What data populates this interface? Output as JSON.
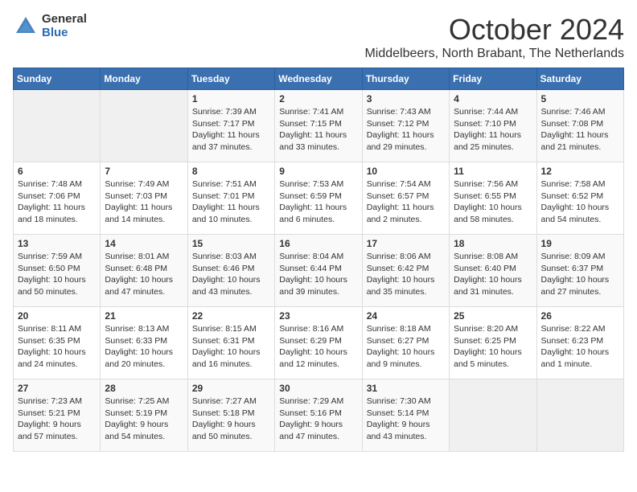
{
  "header": {
    "logo_general": "General",
    "logo_blue": "Blue",
    "month_title": "October 2024",
    "location": "Middelbeers, North Brabant, The Netherlands"
  },
  "days_of_week": [
    "Sunday",
    "Monday",
    "Tuesday",
    "Wednesday",
    "Thursday",
    "Friday",
    "Saturday"
  ],
  "weeks": [
    [
      {
        "day": "",
        "content": ""
      },
      {
        "day": "",
        "content": ""
      },
      {
        "day": "1",
        "content": "Sunrise: 7:39 AM\nSunset: 7:17 PM\nDaylight: 11 hours and 37 minutes."
      },
      {
        "day": "2",
        "content": "Sunrise: 7:41 AM\nSunset: 7:15 PM\nDaylight: 11 hours and 33 minutes."
      },
      {
        "day": "3",
        "content": "Sunrise: 7:43 AM\nSunset: 7:12 PM\nDaylight: 11 hours and 29 minutes."
      },
      {
        "day": "4",
        "content": "Sunrise: 7:44 AM\nSunset: 7:10 PM\nDaylight: 11 hours and 25 minutes."
      },
      {
        "day": "5",
        "content": "Sunrise: 7:46 AM\nSunset: 7:08 PM\nDaylight: 11 hours and 21 minutes."
      }
    ],
    [
      {
        "day": "6",
        "content": "Sunrise: 7:48 AM\nSunset: 7:06 PM\nDaylight: 11 hours and 18 minutes."
      },
      {
        "day": "7",
        "content": "Sunrise: 7:49 AM\nSunset: 7:03 PM\nDaylight: 11 hours and 14 minutes."
      },
      {
        "day": "8",
        "content": "Sunrise: 7:51 AM\nSunset: 7:01 PM\nDaylight: 11 hours and 10 minutes."
      },
      {
        "day": "9",
        "content": "Sunrise: 7:53 AM\nSunset: 6:59 PM\nDaylight: 11 hours and 6 minutes."
      },
      {
        "day": "10",
        "content": "Sunrise: 7:54 AM\nSunset: 6:57 PM\nDaylight: 11 hours and 2 minutes."
      },
      {
        "day": "11",
        "content": "Sunrise: 7:56 AM\nSunset: 6:55 PM\nDaylight: 10 hours and 58 minutes."
      },
      {
        "day": "12",
        "content": "Sunrise: 7:58 AM\nSunset: 6:52 PM\nDaylight: 10 hours and 54 minutes."
      }
    ],
    [
      {
        "day": "13",
        "content": "Sunrise: 7:59 AM\nSunset: 6:50 PM\nDaylight: 10 hours and 50 minutes."
      },
      {
        "day": "14",
        "content": "Sunrise: 8:01 AM\nSunset: 6:48 PM\nDaylight: 10 hours and 47 minutes."
      },
      {
        "day": "15",
        "content": "Sunrise: 8:03 AM\nSunset: 6:46 PM\nDaylight: 10 hours and 43 minutes."
      },
      {
        "day": "16",
        "content": "Sunrise: 8:04 AM\nSunset: 6:44 PM\nDaylight: 10 hours and 39 minutes."
      },
      {
        "day": "17",
        "content": "Sunrise: 8:06 AM\nSunset: 6:42 PM\nDaylight: 10 hours and 35 minutes."
      },
      {
        "day": "18",
        "content": "Sunrise: 8:08 AM\nSunset: 6:40 PM\nDaylight: 10 hours and 31 minutes."
      },
      {
        "day": "19",
        "content": "Sunrise: 8:09 AM\nSunset: 6:37 PM\nDaylight: 10 hours and 27 minutes."
      }
    ],
    [
      {
        "day": "20",
        "content": "Sunrise: 8:11 AM\nSunset: 6:35 PM\nDaylight: 10 hours and 24 minutes."
      },
      {
        "day": "21",
        "content": "Sunrise: 8:13 AM\nSunset: 6:33 PM\nDaylight: 10 hours and 20 minutes."
      },
      {
        "day": "22",
        "content": "Sunrise: 8:15 AM\nSunset: 6:31 PM\nDaylight: 10 hours and 16 minutes."
      },
      {
        "day": "23",
        "content": "Sunrise: 8:16 AM\nSunset: 6:29 PM\nDaylight: 10 hours and 12 minutes."
      },
      {
        "day": "24",
        "content": "Sunrise: 8:18 AM\nSunset: 6:27 PM\nDaylight: 10 hours and 9 minutes."
      },
      {
        "day": "25",
        "content": "Sunrise: 8:20 AM\nSunset: 6:25 PM\nDaylight: 10 hours and 5 minutes."
      },
      {
        "day": "26",
        "content": "Sunrise: 8:22 AM\nSunset: 6:23 PM\nDaylight: 10 hours and 1 minute."
      }
    ],
    [
      {
        "day": "27",
        "content": "Sunrise: 7:23 AM\nSunset: 5:21 PM\nDaylight: 9 hours and 57 minutes."
      },
      {
        "day": "28",
        "content": "Sunrise: 7:25 AM\nSunset: 5:19 PM\nDaylight: 9 hours and 54 minutes."
      },
      {
        "day": "29",
        "content": "Sunrise: 7:27 AM\nSunset: 5:18 PM\nDaylight: 9 hours and 50 minutes."
      },
      {
        "day": "30",
        "content": "Sunrise: 7:29 AM\nSunset: 5:16 PM\nDaylight: 9 hours and 47 minutes."
      },
      {
        "day": "31",
        "content": "Sunrise: 7:30 AM\nSunset: 5:14 PM\nDaylight: 9 hours and 43 minutes."
      },
      {
        "day": "",
        "content": ""
      },
      {
        "day": "",
        "content": ""
      }
    ]
  ]
}
